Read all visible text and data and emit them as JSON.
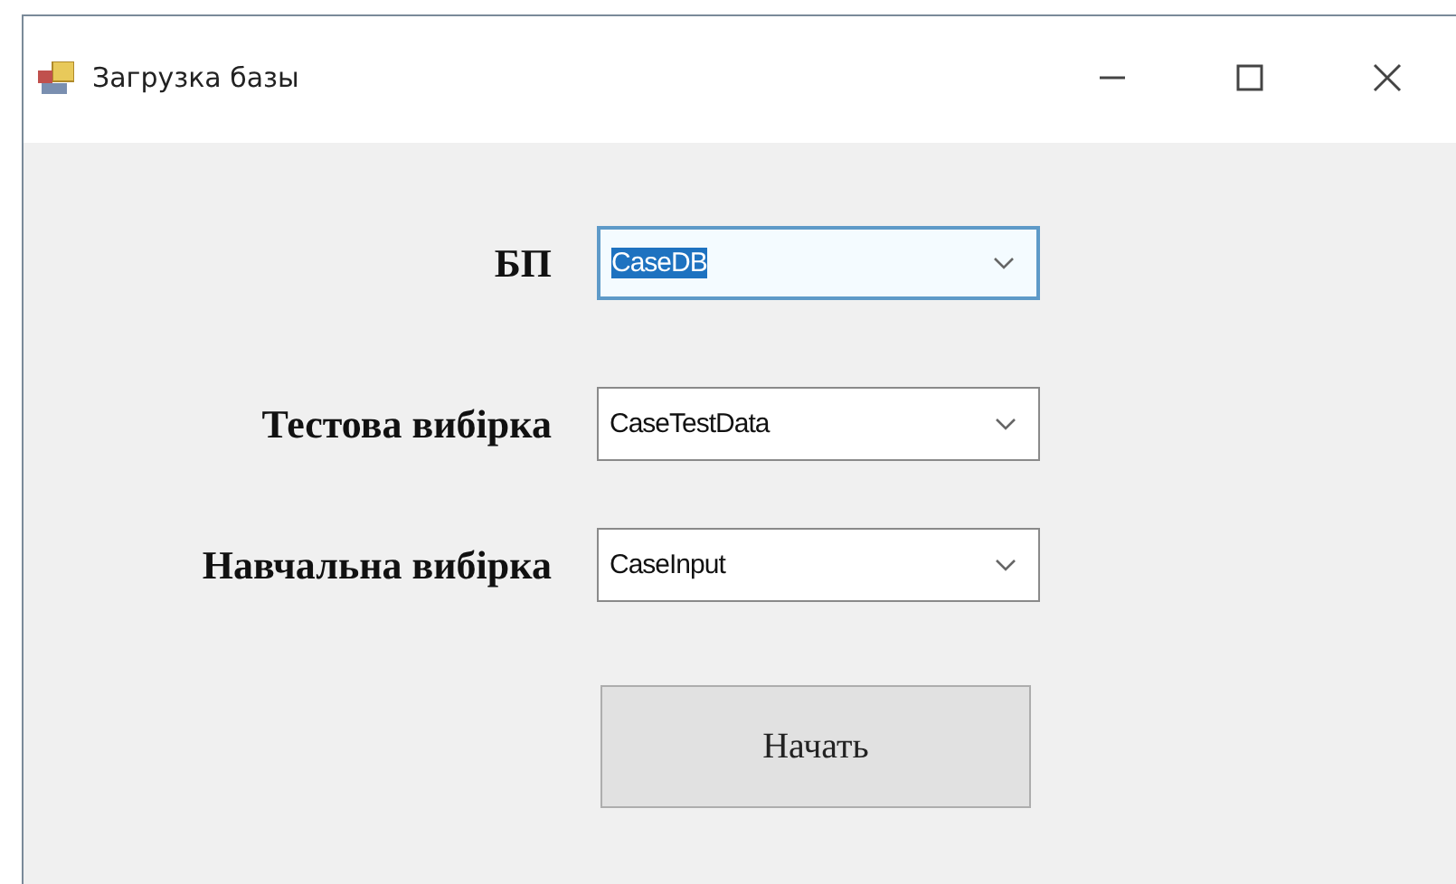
{
  "window": {
    "title": "Загрузка базы"
  },
  "fields": [
    {
      "label": "БП",
      "value": "CaseDB",
      "focused": true
    },
    {
      "label": "Тестова вибірка",
      "value": "CaseTestData",
      "focused": false
    },
    {
      "label": "Навчальна вибірка",
      "value": "CaseInput",
      "focused": false
    }
  ],
  "buttons": [
    "Начать"
  ]
}
